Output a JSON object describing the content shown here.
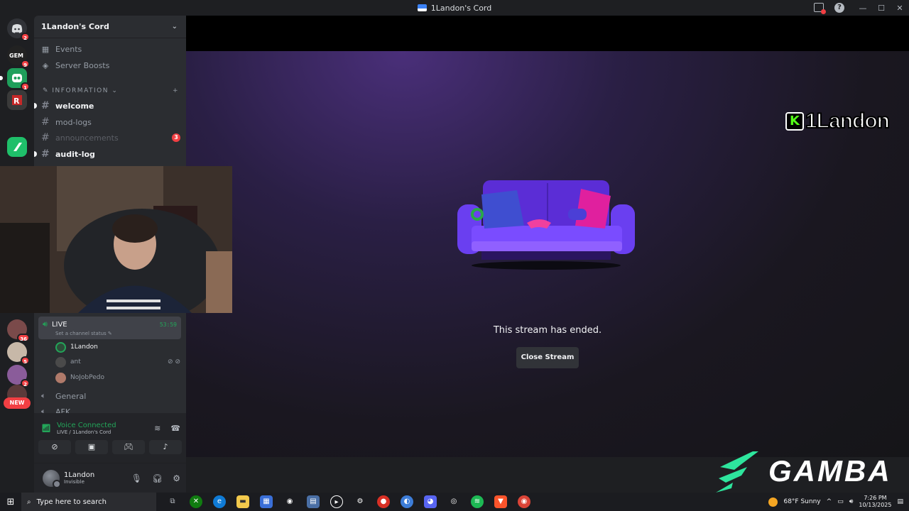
{
  "window": {
    "title": "1Landon's Cord"
  },
  "server": {
    "name": "1Landon's Cord"
  },
  "guild_badges": [
    "2",
    "9",
    "1",
    "36",
    "5",
    "2"
  ],
  "guild_new_label": "NEW",
  "sidebar": {
    "events_label": "Events",
    "boosts_label": "Server Boosts",
    "category": "INFORMATION",
    "channels": [
      {
        "name": "welcome"
      },
      {
        "name": "mod-logs"
      },
      {
        "name": "announcements",
        "mentions": "3"
      },
      {
        "name": "audit-log"
      }
    ]
  },
  "voice": {
    "channel_name": "LIVE",
    "timer": "53:59",
    "status_placeholder": "Set a channel status",
    "users": [
      {
        "name": "1Landon"
      },
      {
        "name": "ant"
      },
      {
        "name": "NoJobPedo"
      }
    ],
    "other_channels": [
      "General",
      "AFK"
    ]
  },
  "voice_panel": {
    "title": "Voice Connected",
    "subtitle": "LIVE / 1Landon's Cord"
  },
  "user": {
    "name": "1Landon",
    "status": "Invisible"
  },
  "stream": {
    "message": "This stream has ended.",
    "close_label": "Close Stream",
    "overlay_name": "1Landon",
    "overlay_k": "K",
    "sponsor": "GAMBA"
  },
  "taskbar": {
    "search_placeholder": "Type here to search",
    "weather": "68°F  Sunny",
    "time": "7:26 PM",
    "date": "10/13/2025"
  },
  "colors": {
    "accent_green": "#23a559",
    "mention_red": "#f23f43",
    "gamba_green": "#2ee59d"
  }
}
